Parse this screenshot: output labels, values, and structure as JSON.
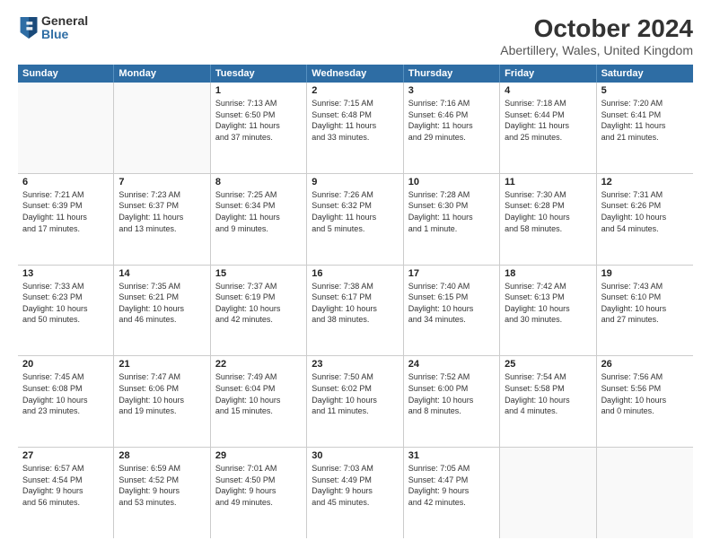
{
  "logo": {
    "general": "General",
    "blue": "Blue"
  },
  "title": "October 2024",
  "subtitle": "Abertillery, Wales, United Kingdom",
  "headers": [
    "Sunday",
    "Monday",
    "Tuesday",
    "Wednesday",
    "Thursday",
    "Friday",
    "Saturday"
  ],
  "rows": [
    [
      {
        "day": "",
        "text": "",
        "empty": true
      },
      {
        "day": "",
        "text": "",
        "empty": true
      },
      {
        "day": "1",
        "text": "Sunrise: 7:13 AM\nSunset: 6:50 PM\nDaylight: 11 hours\nand 37 minutes."
      },
      {
        "day": "2",
        "text": "Sunrise: 7:15 AM\nSunset: 6:48 PM\nDaylight: 11 hours\nand 33 minutes."
      },
      {
        "day": "3",
        "text": "Sunrise: 7:16 AM\nSunset: 6:46 PM\nDaylight: 11 hours\nand 29 minutes."
      },
      {
        "day": "4",
        "text": "Sunrise: 7:18 AM\nSunset: 6:44 PM\nDaylight: 11 hours\nand 25 minutes."
      },
      {
        "day": "5",
        "text": "Sunrise: 7:20 AM\nSunset: 6:41 PM\nDaylight: 11 hours\nand 21 minutes."
      }
    ],
    [
      {
        "day": "6",
        "text": "Sunrise: 7:21 AM\nSunset: 6:39 PM\nDaylight: 11 hours\nand 17 minutes."
      },
      {
        "day": "7",
        "text": "Sunrise: 7:23 AM\nSunset: 6:37 PM\nDaylight: 11 hours\nand 13 minutes."
      },
      {
        "day": "8",
        "text": "Sunrise: 7:25 AM\nSunset: 6:34 PM\nDaylight: 11 hours\nand 9 minutes."
      },
      {
        "day": "9",
        "text": "Sunrise: 7:26 AM\nSunset: 6:32 PM\nDaylight: 11 hours\nand 5 minutes."
      },
      {
        "day": "10",
        "text": "Sunrise: 7:28 AM\nSunset: 6:30 PM\nDaylight: 11 hours\nand 1 minute."
      },
      {
        "day": "11",
        "text": "Sunrise: 7:30 AM\nSunset: 6:28 PM\nDaylight: 10 hours\nand 58 minutes."
      },
      {
        "day": "12",
        "text": "Sunrise: 7:31 AM\nSunset: 6:26 PM\nDaylight: 10 hours\nand 54 minutes."
      }
    ],
    [
      {
        "day": "13",
        "text": "Sunrise: 7:33 AM\nSunset: 6:23 PM\nDaylight: 10 hours\nand 50 minutes."
      },
      {
        "day": "14",
        "text": "Sunrise: 7:35 AM\nSunset: 6:21 PM\nDaylight: 10 hours\nand 46 minutes."
      },
      {
        "day": "15",
        "text": "Sunrise: 7:37 AM\nSunset: 6:19 PM\nDaylight: 10 hours\nand 42 minutes."
      },
      {
        "day": "16",
        "text": "Sunrise: 7:38 AM\nSunset: 6:17 PM\nDaylight: 10 hours\nand 38 minutes."
      },
      {
        "day": "17",
        "text": "Sunrise: 7:40 AM\nSunset: 6:15 PM\nDaylight: 10 hours\nand 34 minutes."
      },
      {
        "day": "18",
        "text": "Sunrise: 7:42 AM\nSunset: 6:13 PM\nDaylight: 10 hours\nand 30 minutes."
      },
      {
        "day": "19",
        "text": "Sunrise: 7:43 AM\nSunset: 6:10 PM\nDaylight: 10 hours\nand 27 minutes."
      }
    ],
    [
      {
        "day": "20",
        "text": "Sunrise: 7:45 AM\nSunset: 6:08 PM\nDaylight: 10 hours\nand 23 minutes."
      },
      {
        "day": "21",
        "text": "Sunrise: 7:47 AM\nSunset: 6:06 PM\nDaylight: 10 hours\nand 19 minutes."
      },
      {
        "day": "22",
        "text": "Sunrise: 7:49 AM\nSunset: 6:04 PM\nDaylight: 10 hours\nand 15 minutes."
      },
      {
        "day": "23",
        "text": "Sunrise: 7:50 AM\nSunset: 6:02 PM\nDaylight: 10 hours\nand 11 minutes."
      },
      {
        "day": "24",
        "text": "Sunrise: 7:52 AM\nSunset: 6:00 PM\nDaylight: 10 hours\nand 8 minutes."
      },
      {
        "day": "25",
        "text": "Sunrise: 7:54 AM\nSunset: 5:58 PM\nDaylight: 10 hours\nand 4 minutes."
      },
      {
        "day": "26",
        "text": "Sunrise: 7:56 AM\nSunset: 5:56 PM\nDaylight: 10 hours\nand 0 minutes."
      }
    ],
    [
      {
        "day": "27",
        "text": "Sunrise: 6:57 AM\nSunset: 4:54 PM\nDaylight: 9 hours\nand 56 minutes."
      },
      {
        "day": "28",
        "text": "Sunrise: 6:59 AM\nSunset: 4:52 PM\nDaylight: 9 hours\nand 53 minutes."
      },
      {
        "day": "29",
        "text": "Sunrise: 7:01 AM\nSunset: 4:50 PM\nDaylight: 9 hours\nand 49 minutes."
      },
      {
        "day": "30",
        "text": "Sunrise: 7:03 AM\nSunset: 4:49 PM\nDaylight: 9 hours\nand 45 minutes."
      },
      {
        "day": "31",
        "text": "Sunrise: 7:05 AM\nSunset: 4:47 PM\nDaylight: 9 hours\nand 42 minutes."
      },
      {
        "day": "",
        "text": "",
        "empty": true
      },
      {
        "day": "",
        "text": "",
        "empty": true
      }
    ]
  ]
}
